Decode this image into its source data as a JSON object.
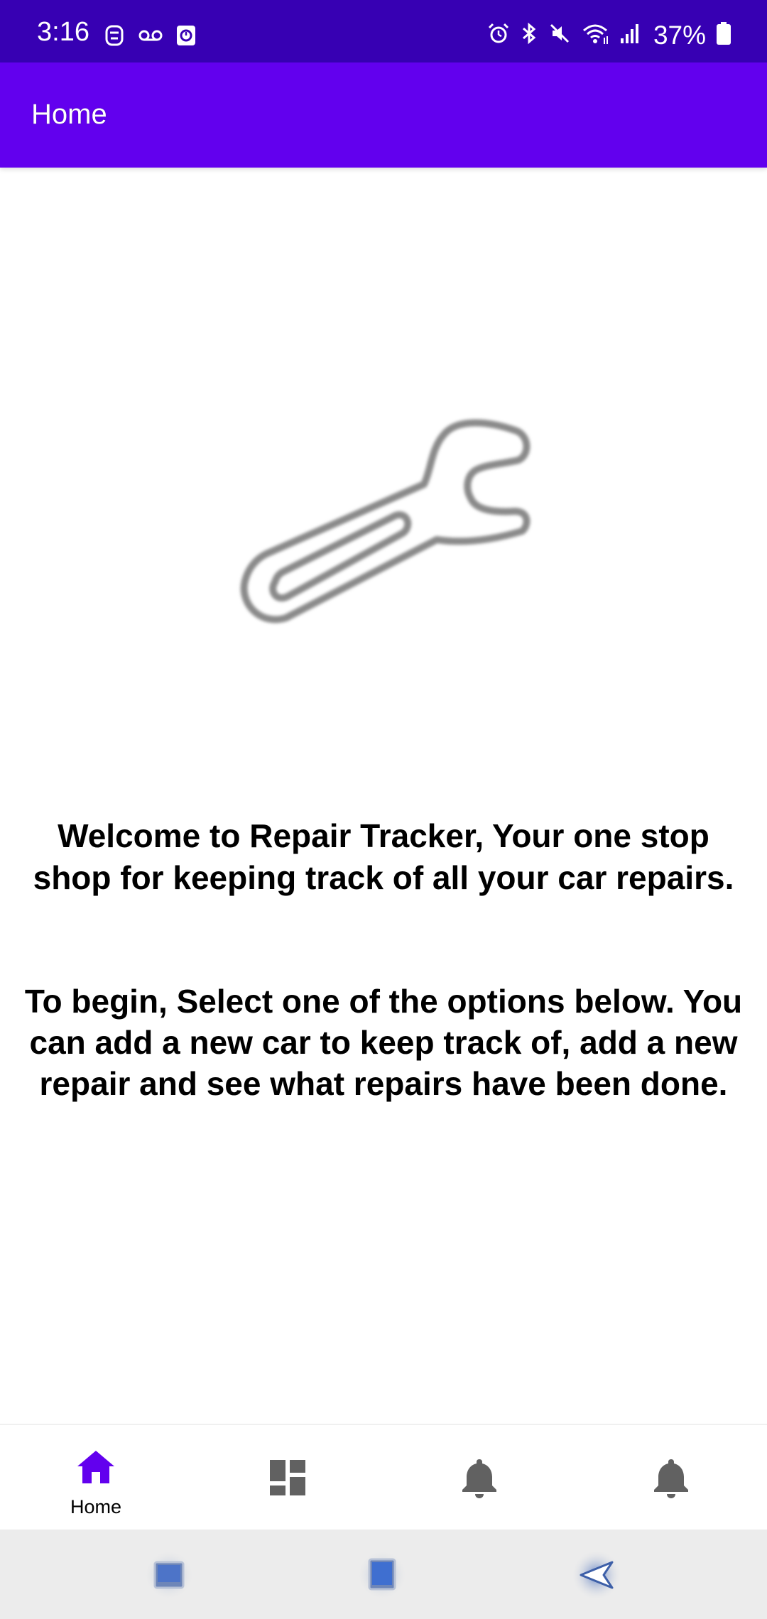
{
  "status_bar": {
    "time": "3:16",
    "battery_percent": "37%",
    "left_icons": [
      "face-icon",
      "voicemail-icon",
      "clock-app-icon"
    ],
    "right_icons": [
      "alarm-icon",
      "bluetooth-icon",
      "mute-icon",
      "wifi-icon",
      "signal-icon",
      "battery-icon"
    ],
    "background": "#3700b3"
  },
  "app_bar": {
    "title": "Home",
    "background": "#6200ee"
  },
  "main": {
    "hero_icon": "wrench-icon",
    "welcome_text": "Welcome to Repair Tracker, Your one stop shop for keeping track of all your car repairs.",
    "instruction_text": "To begin, Select one of the options below. You can add a new car to keep track of, add a new repair and see what repairs have been done."
  },
  "bottom_nav": {
    "items": [
      {
        "icon": "home-icon",
        "label": "Home",
        "active": true
      },
      {
        "icon": "dashboard-icon",
        "label": "",
        "active": false
      },
      {
        "icon": "notifications-icon",
        "label": "",
        "active": false
      },
      {
        "icon": "notifications-icon",
        "label": "",
        "active": false
      }
    ],
    "active_color": "#6200ee",
    "inactive_color": "#616161"
  },
  "system_nav": {
    "buttons": [
      "recent-apps-icon",
      "home-screen-icon",
      "back-icon"
    ]
  }
}
